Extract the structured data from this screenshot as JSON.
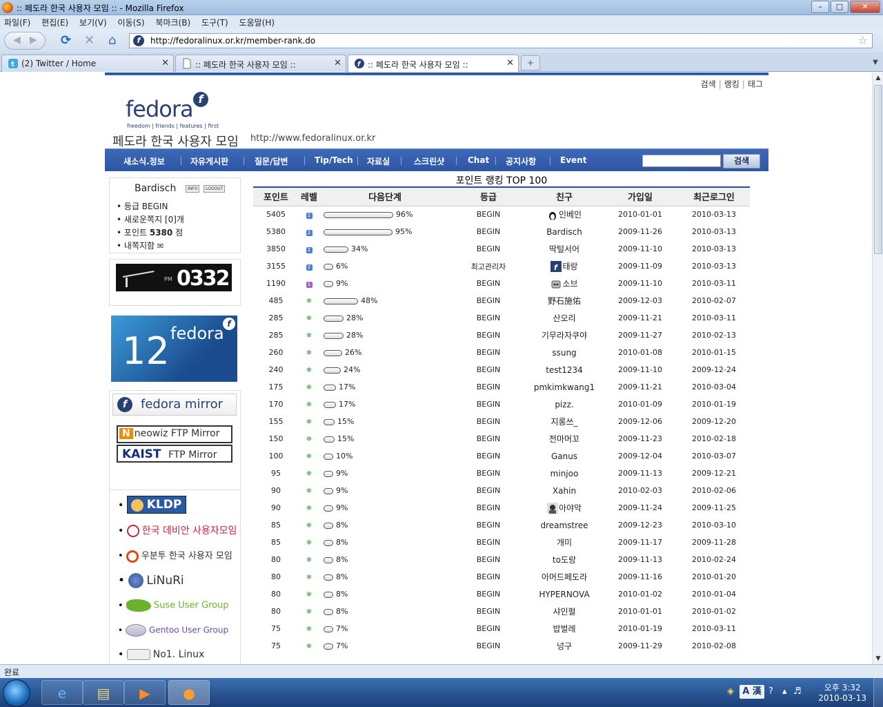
{
  "window": {
    "title": ":: 페도라 한국 사용자 모임 :: - Mozilla Firefox"
  },
  "menu": [
    "파일(F)",
    "편집(E)",
    "보기(V)",
    "이동(S)",
    "북마크(B)",
    "도구(T)",
    "도움말(H)"
  ],
  "url": "http://fedoralinux.or.kr/member-rank.do",
  "tabs": [
    {
      "label": "(2) Twitter / Home"
    },
    {
      "label": ":: 페도라 한국 사용자 모임 ::"
    },
    {
      "label": ":: 페도라 한국 사용자 모임 ::"
    }
  ],
  "site": {
    "toplinks": [
      "검색",
      "랭킹",
      "태그"
    ],
    "logo_word": "fedora",
    "logo_tagline": "freedom | friends | features | first",
    "name": "페도라 한국 사용자 모임",
    "url_text": "http://www.fedoralinux.or.kr",
    "nav": [
      "새소식.정보",
      "자유게시판",
      "질문/답변",
      "Tip/Tech",
      "자료실",
      "스크린샷",
      "Chat",
      "공지사항",
      "Event"
    ],
    "search_button": "검색"
  },
  "user": {
    "name": "Bardisch",
    "info_chip": "INFO",
    "logout_chip": "LOGOUT",
    "grade": "등급 BEGIN",
    "new_messages": "새로운쪽지 [0]개",
    "points_label": "포인트",
    "points_value": "5380",
    "points_unit": "점",
    "messagebox": "내쪽지함"
  },
  "clock": {
    "ampm": "PM",
    "time": "0332"
  },
  "banner": {
    "number": "12",
    "word": "fedora"
  },
  "mirror": {
    "title": "fedora mirror",
    "neowiz_tag": "N",
    "neowiz": "neowiz FTP Mirror",
    "kaist_tag": "KAIST",
    "kaist": "FTP Mirror"
  },
  "links": {
    "kldp": "KLDP",
    "debian": "한국 데비안 사용자모임",
    "ubuntu": "우분투 한국 사용자 모임",
    "linuri": "LiNuRi",
    "suse": "Suse User Group",
    "gentoo": "Gentoo User Group",
    "no1": "No1. Linux"
  },
  "rank": {
    "title": "포인트 랭킹 TOP 100",
    "columns": [
      "포인트",
      "레벨",
      "다음단계",
      "등급",
      "친구",
      "가입일",
      "최근로그인"
    ],
    "rows": [
      {
        "points": "5405",
        "level": 2,
        "progress": 96,
        "grade": "BEGIN",
        "friend": "인베인",
        "joined": "2010-01-01",
        "last": "2010-03-13",
        "avatar": "tux"
      },
      {
        "points": "5380",
        "level": 2,
        "progress": 95,
        "grade": "BEGIN",
        "friend": "Bardisch",
        "joined": "2009-11-26",
        "last": "2010-03-13",
        "avatar": ""
      },
      {
        "points": "3850",
        "level": 2,
        "progress": 34,
        "grade": "BEGIN",
        "friend": "딱털서어",
        "joined": "2009-11-10",
        "last": "2010-03-13",
        "avatar": ""
      },
      {
        "points": "3155",
        "level": 2,
        "progress": 6,
        "grade": "최고관리자",
        "friend": "태랑",
        "joined": "2009-11-09",
        "last": "2010-03-13",
        "avatar": "fedora"
      },
      {
        "points": "1190",
        "level": 1,
        "progress": 9,
        "grade": "BEGIN",
        "friend": "소브",
        "joined": "2009-11-10",
        "last": "2010-03-11",
        "avatar": "robot"
      },
      {
        "points": "485",
        "level": 0,
        "progress": 48,
        "grade": "BEGIN",
        "friend": "野石施佑",
        "joined": "2009-12-03",
        "last": "2010-02-07",
        "avatar": ""
      },
      {
        "points": "285",
        "level": 0,
        "progress": 28,
        "grade": "BEGIN",
        "friend": "산오리",
        "joined": "2009-11-21",
        "last": "2010-03-11",
        "avatar": ""
      },
      {
        "points": "285",
        "level": 0,
        "progress": 28,
        "grade": "BEGIN",
        "friend": "기무라자쿠야",
        "joined": "2009-11-27",
        "last": "2010-02-13",
        "avatar": ""
      },
      {
        "points": "260",
        "level": 0,
        "progress": 26,
        "grade": "BEGIN",
        "friend": "ssung",
        "joined": "2010-01-08",
        "last": "2010-01-15",
        "avatar": ""
      },
      {
        "points": "240",
        "level": 0,
        "progress": 24,
        "grade": "BEGIN",
        "friend": "test1234",
        "joined": "2009-11-10",
        "last": "2009-12-24",
        "avatar": ""
      },
      {
        "points": "175",
        "level": 0,
        "progress": 17,
        "grade": "BEGIN",
        "friend": "pmkimkwang1",
        "joined": "2009-11-21",
        "last": "2010-03-04",
        "avatar": ""
      },
      {
        "points": "170",
        "level": 0,
        "progress": 17,
        "grade": "BEGIN",
        "friend": "pizz.",
        "joined": "2010-01-09",
        "last": "2010-01-19",
        "avatar": ""
      },
      {
        "points": "155",
        "level": 0,
        "progress": 15,
        "grade": "BEGIN",
        "friend": "지롱쓰_",
        "joined": "2009-12-06",
        "last": "2009-12-20",
        "avatar": ""
      },
      {
        "points": "150",
        "level": 0,
        "progress": 15,
        "grade": "BEGIN",
        "friend": "전마머꼬",
        "joined": "2009-11-23",
        "last": "2010-02-18",
        "avatar": ""
      },
      {
        "points": "100",
        "level": 0,
        "progress": 10,
        "grade": "BEGIN",
        "friend": "Ganus",
        "joined": "2009-12-04",
        "last": "2010-03-07",
        "avatar": ""
      },
      {
        "points": "95",
        "level": 0,
        "progress": 9,
        "grade": "BEGIN",
        "friend": "minjoo",
        "joined": "2009-11-13",
        "last": "2009-12-21",
        "avatar": ""
      },
      {
        "points": "90",
        "level": 0,
        "progress": 9,
        "grade": "BEGIN",
        "friend": "Xahin",
        "joined": "2010-02-03",
        "last": "2010-02-06",
        "avatar": ""
      },
      {
        "points": "90",
        "level": 0,
        "progress": 9,
        "grade": "BEGIN",
        "friend": "아야악",
        "joined": "2009-11-24",
        "last": "2009-11-25",
        "avatar": "photo"
      },
      {
        "points": "85",
        "level": 0,
        "progress": 8,
        "grade": "BEGIN",
        "friend": "dreamstree",
        "joined": "2009-12-23",
        "last": "2010-03-10",
        "avatar": ""
      },
      {
        "points": "85",
        "level": 0,
        "progress": 8,
        "grade": "BEGIN",
        "friend": "개미",
        "joined": "2009-11-17",
        "last": "2009-11-28",
        "avatar": ""
      },
      {
        "points": "80",
        "level": 0,
        "progress": 8,
        "grade": "BEGIN",
        "friend": "to도랑",
        "joined": "2009-11-13",
        "last": "2010-02-24",
        "avatar": ""
      },
      {
        "points": "80",
        "level": 0,
        "progress": 8,
        "grade": "BEGIN",
        "friend": "아머드페도라",
        "joined": "2009-11-16",
        "last": "2010-01-20",
        "avatar": ""
      },
      {
        "points": "80",
        "level": 0,
        "progress": 8,
        "grade": "BEGIN",
        "friend": "HYPERNOVA",
        "joined": "2010-01-02",
        "last": "2010-01-04",
        "avatar": ""
      },
      {
        "points": "80",
        "level": 0,
        "progress": 8,
        "grade": "BEGIN",
        "friend": "샤인펄",
        "joined": "2010-01-01",
        "last": "2010-01-02",
        "avatar": ""
      },
      {
        "points": "75",
        "level": 0,
        "progress": 7,
        "grade": "BEGIN",
        "friend": "밥벌레",
        "joined": "2010-01-19",
        "last": "2010-03-11",
        "avatar": ""
      },
      {
        "points": "75",
        "level": 0,
        "progress": 7,
        "grade": "BEGIN",
        "friend": "넝구",
        "joined": "2009-11-29",
        "last": "2010-02-08",
        "avatar": ""
      }
    ]
  },
  "status": "완료",
  "taskbar": {
    "time": "오후 3:32",
    "date": "2010-03-13",
    "ime": "A 漢"
  }
}
